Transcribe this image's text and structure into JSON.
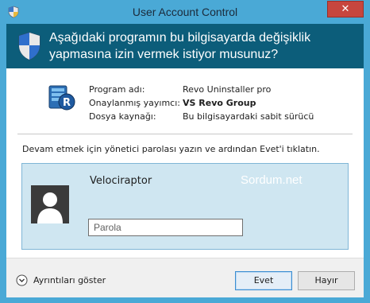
{
  "window": {
    "title": "User Account Control",
    "close_glyph": "✕"
  },
  "banner": {
    "icon": "shield-icon",
    "line1": "Aşağıdaki programın bu bilgisayarda değişiklik",
    "line2": "yapmasına izin vermek istiyor musunuz?"
  },
  "program_info": {
    "icon": "revo-uninstaller-icon",
    "rows": [
      {
        "label": "Program adı:",
        "value": "Revo Uninstaller pro"
      },
      {
        "label": "Onaylanmış yayımcı:",
        "value": "VS Revo Group"
      },
      {
        "label": "Dosya kaynağı:",
        "value": "Bu bilgisayardaki sabit sürücü"
      }
    ]
  },
  "instruction": "Devam etmek için yönetici parolası yazın ve ardından Evet'i tıklatın.",
  "credential": {
    "avatar_icon": "user-avatar-icon",
    "username": "Velociraptor",
    "watermark": "Sordum.net",
    "password_placeholder": "Parola",
    "password_value": ""
  },
  "footer": {
    "details_label": "Ayrıntıları göster",
    "yes_label": "Evet",
    "no_label": "Hayır"
  },
  "colors": {
    "frame": "#4aa9d6",
    "banner": "#0c5d7a",
    "tile": "#cfe6f1",
    "close": "#c7463e"
  }
}
